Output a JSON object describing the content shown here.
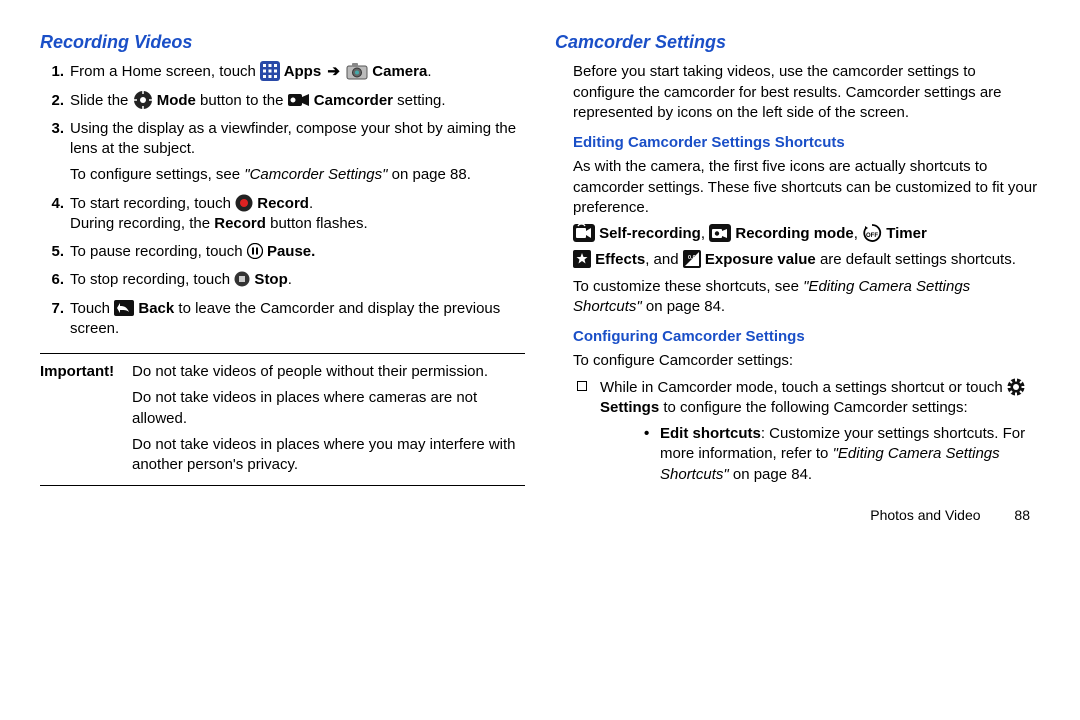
{
  "left": {
    "title": "Recording Videos",
    "steps": {
      "s1a": "From a Home screen, touch ",
      "s1_apps": " Apps ",
      "s1_arrow": "➔",
      "s1_camera": " Camera",
      "s1_end": ".",
      "s2a": "Slide the ",
      "s2_mode": " Mode",
      "s2b": " button to the ",
      "s2_cam": " Camcorder",
      "s2c": " setting.",
      "s3a": "Using the display as a viewfinder, compose your shot by aiming the lens at the subject.",
      "s3b1": "To configure settings, see ",
      "s3b_ref": "\"Camcorder Settings\"",
      "s3b2": " on page 88.",
      "s4a": "To start recording, touch ",
      "s4_rec": " Record",
      "s4b": ".",
      "s4c1": "During recording, the ",
      "s4c_rec": "Record",
      "s4c2": " button flashes.",
      "s5a": "To pause recording, touch ",
      "s5_pause": " Pause.",
      "s6a": "To stop recording, touch ",
      "s6_stop": " Stop",
      "s6b": ".",
      "s7a": "Touch ",
      "s7_back": " Back",
      "s7b": " to leave the Camcorder and display the previous screen."
    },
    "important": {
      "lead": "Important!",
      "l1": "Do not take videos of people without their permission.",
      "l2": "Do not take videos in places where cameras are not allowed.",
      "l3": "Do not take videos in places where you may interfere with another person's privacy."
    }
  },
  "right": {
    "title": "Camcorder Settings",
    "intro": "Before you start taking videos, use the camcorder settings to configure the camcorder for best results. Camcorder settings are represented by icons on the left side of the screen.",
    "sub1": "Editing Camcorder Settings Shortcuts",
    "sub1_p1": "As with the camera, the first five icons are actually shortcuts to camcorder settings. These five shortcuts can be customized to fit your preference.",
    "line_self": " Self-recording",
    "line_comma1": ", ",
    "line_recmode": " Recording mode",
    "line_comma2": ", ",
    "line_timer": " Timer",
    "line2_effects": " Effects",
    "line2_and": ", and ",
    "line2_exposure": " Exposure value",
    "line2_end": " are default settings shortcuts.",
    "p3a": "To customize these shortcuts, see ",
    "p3_ref": "\"Editing Camera Settings Shortcuts\"",
    "p3b": " on page 84.",
    "sub2": "Configuring Camcorder Settings",
    "sub2_p1": "To configure Camcorder settings:",
    "bullet_a": "While in Camcorder mode, touch a settings shortcut or touch ",
    "bullet_settings": " Settings",
    "bullet_b": " to configure the following Camcorder settings:",
    "subbullet_lead": "Edit shortcuts",
    "subbullet_a": ": Customize your settings shortcuts. For more information, refer to ",
    "subbullet_ref": "\"Editing Camera Settings Shortcuts\"",
    "subbullet_b": " on page 84."
  },
  "footer": {
    "section": "Photos and Video",
    "page": "88"
  }
}
